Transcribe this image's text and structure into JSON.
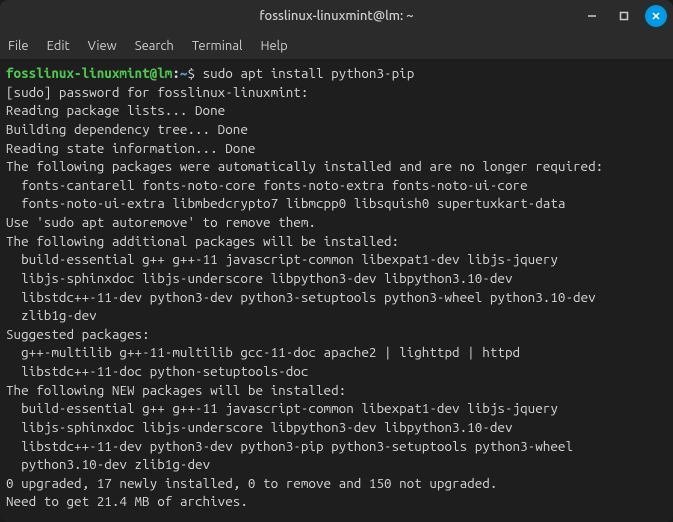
{
  "titlebar": {
    "title": "fosslinux-linuxmint@lm: ~"
  },
  "menubar": {
    "items": [
      "File",
      "Edit",
      "View",
      "Search",
      "Terminal",
      "Help"
    ]
  },
  "prompt": {
    "user_host": "fosslinux-linuxmint@lm",
    "colon": ":",
    "path": "~",
    "dollar": "$ ",
    "command": "sudo apt install python3-pip"
  },
  "output": {
    "lines": [
      "[sudo] password for fosslinux-linuxmint:",
      "Reading package lists... Done",
      "Building dependency tree... Done",
      "Reading state information... Done",
      "The following packages were automatically installed and are no longer required:",
      "  fonts-cantarell fonts-noto-core fonts-noto-extra fonts-noto-ui-core",
      "  fonts-noto-ui-extra libmbedcrypto7 libmcpp0 libsquish0 supertuxkart-data",
      "Use 'sudo apt autoremove' to remove them.",
      "The following additional packages will be installed:",
      "  build-essential g++ g++-11 javascript-common libexpat1-dev libjs-jquery",
      "  libjs-sphinxdoc libjs-underscore libpython3-dev libpython3.10-dev",
      "  libstdc++-11-dev python3-dev python3-setuptools python3-wheel python3.10-dev",
      "  zlib1g-dev",
      "Suggested packages:",
      "  g++-multilib g++-11-multilib gcc-11-doc apache2 | lighttpd | httpd",
      "  libstdc++-11-doc python-setuptools-doc",
      "The following NEW packages will be installed:",
      "  build-essential g++ g++-11 javascript-common libexpat1-dev libjs-jquery",
      "  libjs-sphinxdoc libjs-underscore libpython3-dev libpython3.10-dev",
      "  libstdc++-11-dev python3-dev python3-pip python3-setuptools python3-wheel",
      "  python3.10-dev zlib1g-dev",
      "0 upgraded, 17 newly installed, 0 to remove and 150 not upgraded.",
      "Need to get 21.4 MB of archives."
    ]
  }
}
